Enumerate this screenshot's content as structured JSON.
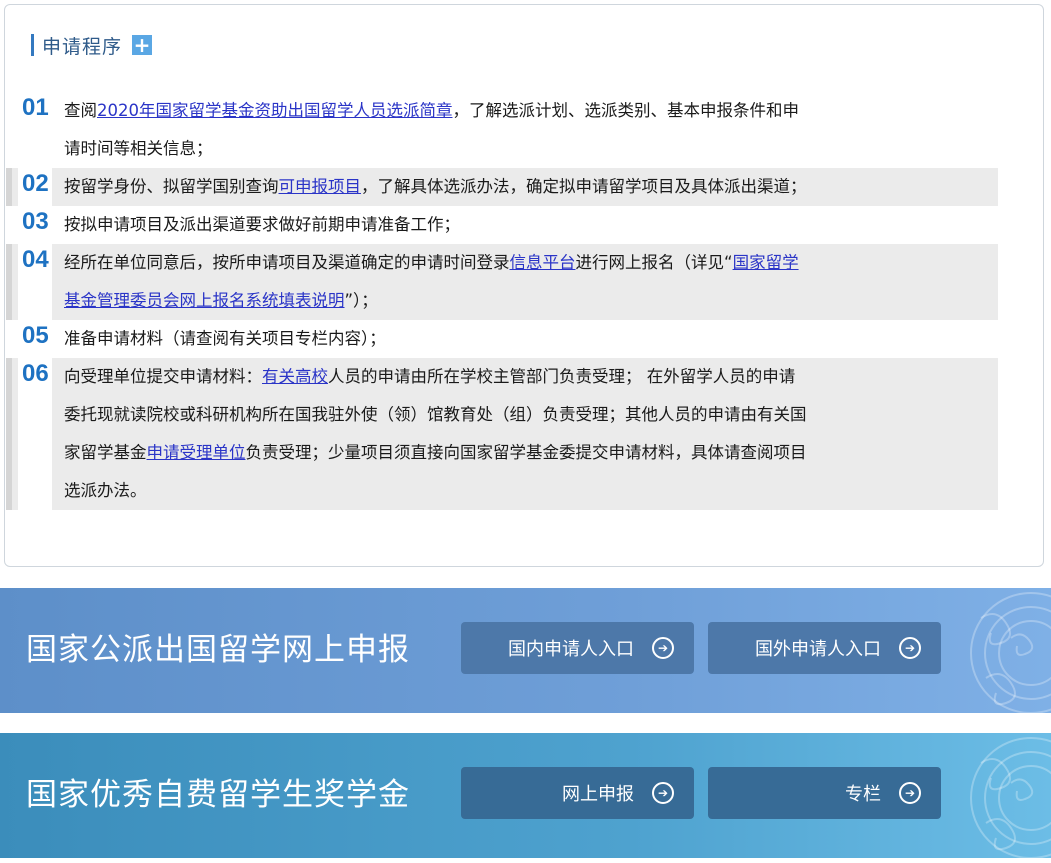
{
  "process": {
    "title": "申请程序",
    "expand_icon": "plus-icon",
    "steps": [
      {
        "num": "01",
        "before": "查阅",
        "link": "2020年国家留学基金资助出国留学人员选派简章",
        "after": "，了解选派计划、选派类别、基本申报条件和申",
        "line2": "请时间等相关信息；"
      },
      {
        "num": "02",
        "before": "按留学身份、拟留学国别查询",
        "link": "可申报项目",
        "after": "，了解具体选派办法，确定拟申请留学项目及具体派出渠道；"
      },
      {
        "num": "03",
        "text": "按拟申请项目及派出渠道要求做好前期申请准备工作；"
      },
      {
        "num": "04",
        "before": "经所在单位同意后，按所申请项目及渠道确定的申请时间登录",
        "link": "信息平台",
        "middle": "进行网上报名（详见“",
        "link2_part1": "国家留学",
        "link2_part2": "基金管理委员会网上报名系统填表说明",
        "after": "”）；"
      },
      {
        "num": "05",
        "text": "准备申请材料（请查阅有关项目专栏内容）；"
      },
      {
        "num": "06",
        "before": "向受理单位提交申请材料：",
        "link": "有关高校",
        "after": "人员的申请由所在学校主管部门负责受理； 在外留学人员的申请",
        "line2": "委托现就读院校或科研机构所在国我驻外使（领）馆教育处（组）负责受理；其他人员的申请由有关国",
        "line3_before": "家留学基金",
        "line3_link": "申请受理单位",
        "line3_after": "负责受理；少量项目须直接向国家留学基金委提交申请材料，具体请查阅项目",
        "line4": "选派办法。"
      }
    ]
  },
  "banners": [
    {
      "title": "国家公派出国留学网上申报",
      "buttons": [
        "国内申请人入口",
        "国外申请人入口"
      ],
      "color": "#6f9fd8"
    },
    {
      "title": "国家优秀自费留学生奖学金",
      "buttons": [
        "网上申报",
        "专栏"
      ],
      "color": "#4ea2cf"
    }
  ],
  "colors": {
    "accent": "#1e72c2",
    "link": "#2a34c7"
  }
}
